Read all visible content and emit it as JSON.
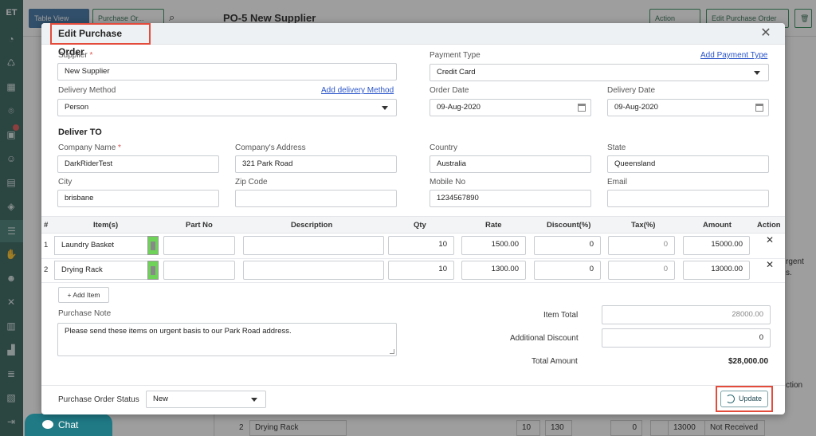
{
  "background": {
    "logo": "ET",
    "table_view": "Table View",
    "purchase_order_btn": "Purchase Or...",
    "page_title": "PO-5 New Supplier",
    "action_btn": "Action",
    "edit_po_btn": "Edit Purchase Order",
    "bg_row": {
      "num": "2",
      "item": "Drying Rack",
      "qty": "10",
      "rate": "130",
      "d": "0",
      "t": "0",
      "amount": "13000",
      "status": "Not Received"
    },
    "fragments": {
      "rgent": "rgent",
      "s": "s.",
      "ction": "ction"
    }
  },
  "chat": {
    "label": "Chat"
  },
  "modal": {
    "title": "Edit Purchase Order",
    "supplier": {
      "label": "Supplier",
      "required": "*",
      "value": "New Supplier"
    },
    "payment_type": {
      "label": "Payment Type",
      "link": "Add Payment Type",
      "value": "Credit Card"
    },
    "delivery_method": {
      "label": "Delivery Method",
      "link": "Add delivery Method",
      "value": "Person"
    },
    "order_date": {
      "label": "Order Date",
      "value": "09-Aug-2020"
    },
    "delivery_date": {
      "label": "Delivery Date",
      "value": "09-Aug-2020"
    },
    "deliver_to": "Deliver TO",
    "company_name": {
      "label": "Company Name",
      "required": "*",
      "value": "DarkRiderTest"
    },
    "company_address": {
      "label": "Company's Address",
      "value": "321 Park Road"
    },
    "country": {
      "label": "Country",
      "value": "Australia"
    },
    "state": {
      "label": "State",
      "value": "Queensland"
    },
    "city": {
      "label": "City",
      "value": "brisbane"
    },
    "zip": {
      "label": "Zip Code",
      "value": ""
    },
    "mobile": {
      "label": "Mobile No",
      "value": "1234567890"
    },
    "email": {
      "label": "Email",
      "value": ""
    },
    "table": {
      "headers": [
        "#",
        "Item(s)",
        "Part No",
        "Description",
        "Qty",
        "Rate",
        "Discount(%)",
        "Tax(%)",
        "Amount",
        "Action"
      ],
      "rows": [
        {
          "num": "1",
          "item": "Laundry Basket",
          "part_no": "",
          "description": "",
          "qty": "10",
          "rate": "1500.00",
          "discount": "0",
          "tax": "0",
          "amount": "15000.00"
        },
        {
          "num": "2",
          "item": "Drying Rack",
          "part_no": "",
          "description": "",
          "qty": "10",
          "rate": "1300.00",
          "discount": "0",
          "tax": "0",
          "amount": "13000.00"
        }
      ]
    },
    "add_item": "Add Item",
    "purchase_note": {
      "label": "Purchase Note",
      "value": "Please send these items on urgent basis to our Park Road address."
    },
    "item_total": {
      "label": "Item Total",
      "value": "28000.00"
    },
    "additional_discount": {
      "label": "Additional Discount",
      "value": "0"
    },
    "total_amount": {
      "label": "Total Amount",
      "value": "$28,000.00"
    },
    "status": {
      "label": "Purchase Order Status",
      "value": "New"
    },
    "update": "Update"
  }
}
